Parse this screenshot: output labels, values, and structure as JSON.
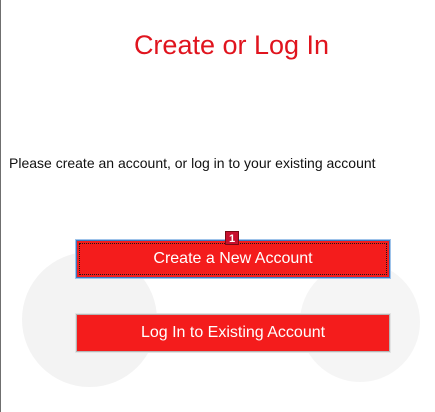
{
  "page": {
    "title": "Create or Log In",
    "message": "Please create an account, or log in to your existing account"
  },
  "buttons": {
    "create_label": "Create a New Account",
    "login_label": "Log In to Existing Account"
  },
  "marker": {
    "label": "1"
  },
  "colors": {
    "title": "#e0141e",
    "button_fill": "#f41c1c",
    "button_text": "#ffffff",
    "focus_border": "#3b78c0",
    "marker": "#c8102e"
  }
}
